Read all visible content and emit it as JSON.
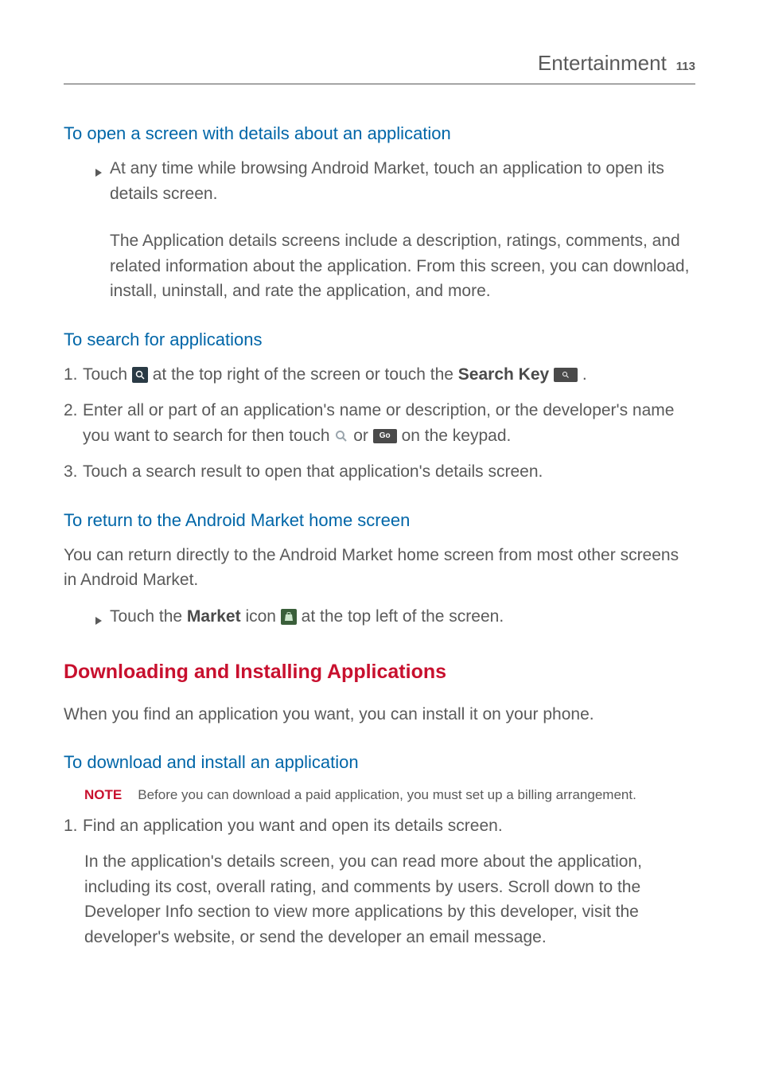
{
  "header": {
    "title": "Entertainment",
    "page": "113"
  },
  "section1": {
    "heading": "To open a screen with details about an application",
    "bullet1": "At any time while browsing Android Market, touch an application to open its details screen.",
    "para1": "The Application details screens include a description, ratings, comments, and related information about the application. From this screen, you can download, install, uninstall, and rate the application, and more."
  },
  "section2": {
    "heading": "To search for applications",
    "item1_a": "Touch ",
    "item1_b": " at the top right of the screen or touch the ",
    "item1_bold": "Search Key",
    "item1_c": " .",
    "item2_a": "Enter all or part of an application's name or description, or the developer's name you want to search for then touch ",
    "item2_b": " or ",
    "item2_c": " on the keypad.",
    "item3": "Touch a search result to open that application's details screen."
  },
  "section3": {
    "heading": "To return to the Android Market home screen",
    "para1": "You can return directly to the Android Market home screen from most other screens in Android Market.",
    "bullet1_a": "Touch the ",
    "bullet1_bold": "Market",
    "bullet1_b": " icon ",
    "bullet1_c": " at the top left of the screen."
  },
  "section4": {
    "heading": "Downloading and Installing Applications",
    "para1": "When you find an application you want, you can install it on your phone."
  },
  "section5": {
    "heading": "To download and install an application",
    "note_label": "NOTE",
    "note_text": "Before you can download a paid application, you must set up a billing arrangement.",
    "item1": "Find an application you want and open its details screen.",
    "para1": "In the application's details screen, you can read more about the application, including its cost, overall rating, and comments by users. Scroll down to the Developer Info section to view more applications by this developer, visit the developer's website, or send the developer an email message."
  },
  "icons": {
    "go_label": "Go"
  }
}
